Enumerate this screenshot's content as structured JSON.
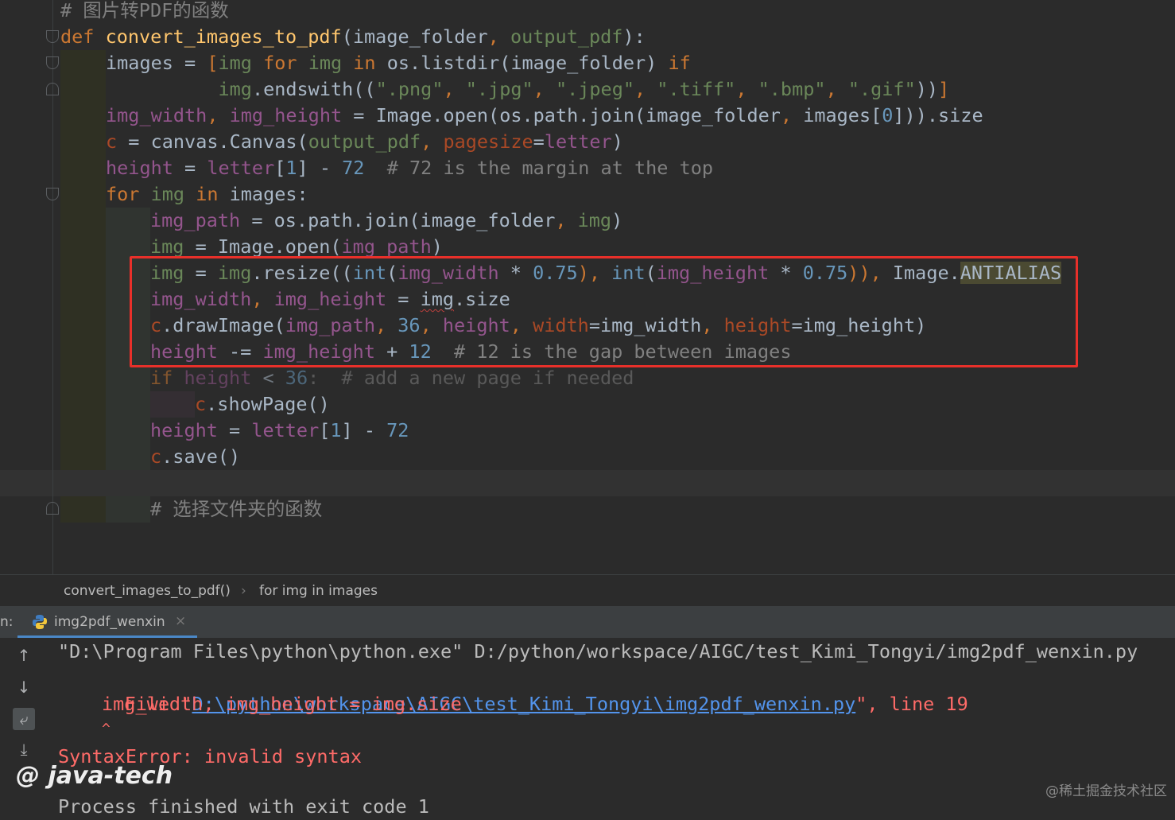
{
  "editor": {
    "code_lines": [
      {
        "indent": 0,
        "tokens": [
          {
            "t": "# 图片转PDF的函数",
            "c": "cm"
          }
        ]
      },
      {
        "indent": 0,
        "tokens": [
          {
            "t": "def ",
            "c": "kw"
          },
          {
            "t": "convert_images_to_pdf",
            "c": "fn"
          },
          {
            "t": "(",
            "c": "var"
          },
          {
            "t": "image_folder",
            "c": "var"
          },
          {
            "t": ", ",
            "c": "kw"
          },
          {
            "t": "output_pdf",
            "c": "str"
          },
          {
            "t": "):",
            "c": "var"
          }
        ]
      },
      {
        "indent": 1,
        "tokens": [
          {
            "t": "images = ",
            "c": "var"
          },
          {
            "t": "[",
            "c": "kw"
          },
          {
            "t": "img ",
            "c": "str"
          },
          {
            "t": "for ",
            "c": "kw"
          },
          {
            "t": "img ",
            "c": "str"
          },
          {
            "t": "in ",
            "c": "kw"
          },
          {
            "t": "os.listdir(image_folder) ",
            "c": "var"
          },
          {
            "t": "if",
            "c": "kw"
          }
        ]
      },
      {
        "indent": 1,
        "tokens": [
          {
            "t": "          img",
            "c": "str"
          },
          {
            "t": ".endswith((",
            "c": "var"
          },
          {
            "t": "\".png\"",
            "c": "str"
          },
          {
            "t": ", ",
            "c": "kw"
          },
          {
            "t": "\".jpg\"",
            "c": "str"
          },
          {
            "t": ", ",
            "c": "kw"
          },
          {
            "t": "\".jpeg\"",
            "c": "str"
          },
          {
            "t": ", ",
            "c": "kw"
          },
          {
            "t": "\".tiff\"",
            "c": "str"
          },
          {
            "t": ", ",
            "c": "kw"
          },
          {
            "t": "\".bmp\"",
            "c": "str"
          },
          {
            "t": ", ",
            "c": "kw"
          },
          {
            "t": "\".gif\"",
            "c": "str"
          },
          {
            "t": "))",
            "c": "var"
          },
          {
            "t": "]",
            "c": "kw"
          }
        ]
      },
      {
        "indent": 1,
        "tokens": [
          {
            "t": "img_width",
            "c": "par"
          },
          {
            "t": ", ",
            "c": "kw"
          },
          {
            "t": "img_height",
            "c": "par"
          },
          {
            "t": " = Image.open(os.path.join(image_folder",
            "c": "var"
          },
          {
            "t": ", ",
            "c": "kw"
          },
          {
            "t": "images[",
            "c": "var"
          },
          {
            "t": "0",
            "c": "num"
          },
          {
            "t": "])).size",
            "c": "var"
          }
        ]
      },
      {
        "indent": 1,
        "tokens": [
          {
            "t": "c",
            "c": "kwarg"
          },
          {
            "t": " = canvas.Canvas(",
            "c": "var"
          },
          {
            "t": "output_pdf",
            "c": "str"
          },
          {
            "t": ", ",
            "c": "kw"
          },
          {
            "t": "pagesize",
            "c": "kwarg"
          },
          {
            "t": "=",
            "c": "var"
          },
          {
            "t": "letter",
            "c": "par"
          },
          {
            "t": ")",
            "c": "var"
          }
        ]
      },
      {
        "indent": 1,
        "tokens": [
          {
            "t": "height",
            "c": "par"
          },
          {
            "t": " = ",
            "c": "var"
          },
          {
            "t": "letter",
            "c": "par"
          },
          {
            "t": "[",
            "c": "var"
          },
          {
            "t": "1",
            "c": "num"
          },
          {
            "t": "] - ",
            "c": "var"
          },
          {
            "t": "72",
            "c": "num"
          },
          {
            "t": "  # 72 is the margin at the top",
            "c": "cm"
          }
        ]
      },
      {
        "indent": 1,
        "tokens": [
          {
            "t": "for ",
            "c": "kw"
          },
          {
            "t": "img ",
            "c": "str"
          },
          {
            "t": "in ",
            "c": "kw"
          },
          {
            "t": "images:",
            "c": "var"
          }
        ]
      },
      {
        "indent": 2,
        "tokens": [
          {
            "t": "img_path",
            "c": "par"
          },
          {
            "t": " = os.path.join(image_folder",
            "c": "var"
          },
          {
            "t": ", ",
            "c": "kw"
          },
          {
            "t": "img",
            "c": "str"
          },
          {
            "t": ")",
            "c": "var"
          }
        ]
      },
      {
        "indent": 2,
        "tokens": [
          {
            "t": "img",
            "c": "str"
          },
          {
            "t": " = Image.open(",
            "c": "var"
          },
          {
            "t": "img_path",
            "c": "par"
          },
          {
            "t": ")",
            "c": "var"
          }
        ]
      },
      {
        "indent": 2,
        "tokens": [
          {
            "t": "img",
            "c": "str"
          },
          {
            "t": " = ",
            "c": "var"
          },
          {
            "t": "img",
            "c": "str"
          },
          {
            "t": ".resize((",
            "c": "var"
          },
          {
            "t": "int",
            "c": "num"
          },
          {
            "t": "(",
            "c": "var"
          },
          {
            "t": "img_width",
            "c": "par"
          },
          {
            "t": " * ",
            "c": "var"
          },
          {
            "t": "0.75",
            "c": "num"
          },
          {
            "t": "), ",
            "c": "kw"
          },
          {
            "t": "int",
            "c": "num"
          },
          {
            "t": "(",
            "c": "var"
          },
          {
            "t": "img_height",
            "c": "par"
          },
          {
            "t": " * ",
            "c": "var"
          },
          {
            "t": "0.75",
            "c": "num"
          },
          {
            "t": ")), ",
            "c": "kw"
          },
          {
            "t": "Image.",
            "c": "var"
          },
          {
            "t": "ANTIALIAS",
            "c": "hl"
          }
        ]
      },
      {
        "indent": 2,
        "tokens": [
          {
            "t": "img_width",
            "c": "par"
          },
          {
            "t": ", ",
            "c": "kw"
          },
          {
            "t": "img_height",
            "c": "par"
          },
          {
            "t": " = ",
            "c": "var"
          },
          {
            "t": "img",
            "c": "squigvar"
          },
          {
            "t": ".size",
            "c": "var"
          }
        ]
      },
      {
        "indent": 2,
        "tokens": [
          {
            "t": "c",
            "c": "kwarg"
          },
          {
            "t": ".drawImage(",
            "c": "var"
          },
          {
            "t": "img_path",
            "c": "par"
          },
          {
            "t": ", ",
            "c": "kw"
          },
          {
            "t": "36",
            "c": "num"
          },
          {
            "t": ", ",
            "c": "kw"
          },
          {
            "t": "height",
            "c": "par"
          },
          {
            "t": ", ",
            "c": "kw"
          },
          {
            "t": "width",
            "c": "kwarg"
          },
          {
            "t": "=img_width",
            "c": "var"
          },
          {
            "t": ", ",
            "c": "kw"
          },
          {
            "t": "height",
            "c": "kwarg"
          },
          {
            "t": "=img_height)",
            "c": "var"
          }
        ]
      },
      {
        "indent": 2,
        "tokens": [
          {
            "t": "height",
            "c": "par"
          },
          {
            "t": " -= ",
            "c": "var"
          },
          {
            "t": "img_height",
            "c": "par"
          },
          {
            "t": " + ",
            "c": "var"
          },
          {
            "t": "12",
            "c": "num"
          },
          {
            "t": "  # 12 is the gap between images",
            "c": "cm"
          }
        ]
      },
      {
        "indent": 2,
        "dim": true,
        "tokens": [
          {
            "t": "if ",
            "c": "kw"
          },
          {
            "t": "height",
            "c": "par"
          },
          {
            "t": " < ",
            "c": "var"
          },
          {
            "t": "36",
            "c": "num"
          },
          {
            "t": ":  # add a new page if needed",
            "c": "cm"
          }
        ]
      },
      {
        "indent": 3,
        "tokens": [
          {
            "t": "c",
            "c": "kwarg"
          },
          {
            "t": ".showPage()",
            "c": "var"
          }
        ]
      },
      {
        "indent": 2,
        "tokens": [
          {
            "t": "height",
            "c": "par"
          },
          {
            "t": " = ",
            "c": "var"
          },
          {
            "t": "letter",
            "c": "par"
          },
          {
            "t": "[",
            "c": "var"
          },
          {
            "t": "1",
            "c": "num"
          },
          {
            "t": "] - ",
            "c": "var"
          },
          {
            "t": "72",
            "c": "num"
          }
        ]
      },
      {
        "indent": 2,
        "tokens": [
          {
            "t": "c",
            "c": "kwarg"
          },
          {
            "t": ".save()",
            "c": "var"
          }
        ]
      },
      {
        "indent": 0,
        "tokens": []
      },
      {
        "indent": 2,
        "tokens": [
          {
            "t": "# 选择文件夹的函数",
            "c": "cm"
          }
        ]
      }
    ]
  },
  "breadcrumb": {
    "func": "convert_images_to_pdf()",
    "sep": "›",
    "block": "for img in images"
  },
  "run_panel": {
    "label_prefix": "n:",
    "tab_label": "img2pdf_wenxin",
    "close_icon": "×",
    "console": {
      "cmd": "\"D:\\Program Files\\python\\python.exe\" D:/python/workspace/AIGC/test_Kimi_Tongyi/img2pdf_wenxin.py",
      "file_prefix": "File \"",
      "file_link": "D:\\python\\workspace\\AIGC\\test_Kimi_Tongyi\\img2pdf_wenxin.py",
      "file_suffix": "\", line 19",
      "code": "img_width, img_height = img.size",
      "caret": "^",
      "error": "SyntaxError: invalid syntax",
      "exit": "Process finished with exit code 1"
    }
  },
  "watermarks": {
    "left": "@ java-tech",
    "right": "@稀土掘金技术社区"
  },
  "colors": {
    "bg": "#2b2b2b",
    "keyword": "#cc7832",
    "function": "#ffc66d",
    "parameter": "#94558d",
    "string": "#6a8759",
    "number": "#6897bb",
    "comment": "#808080",
    "highlight_box": "#e8302a",
    "error": "#ff6b68"
  }
}
